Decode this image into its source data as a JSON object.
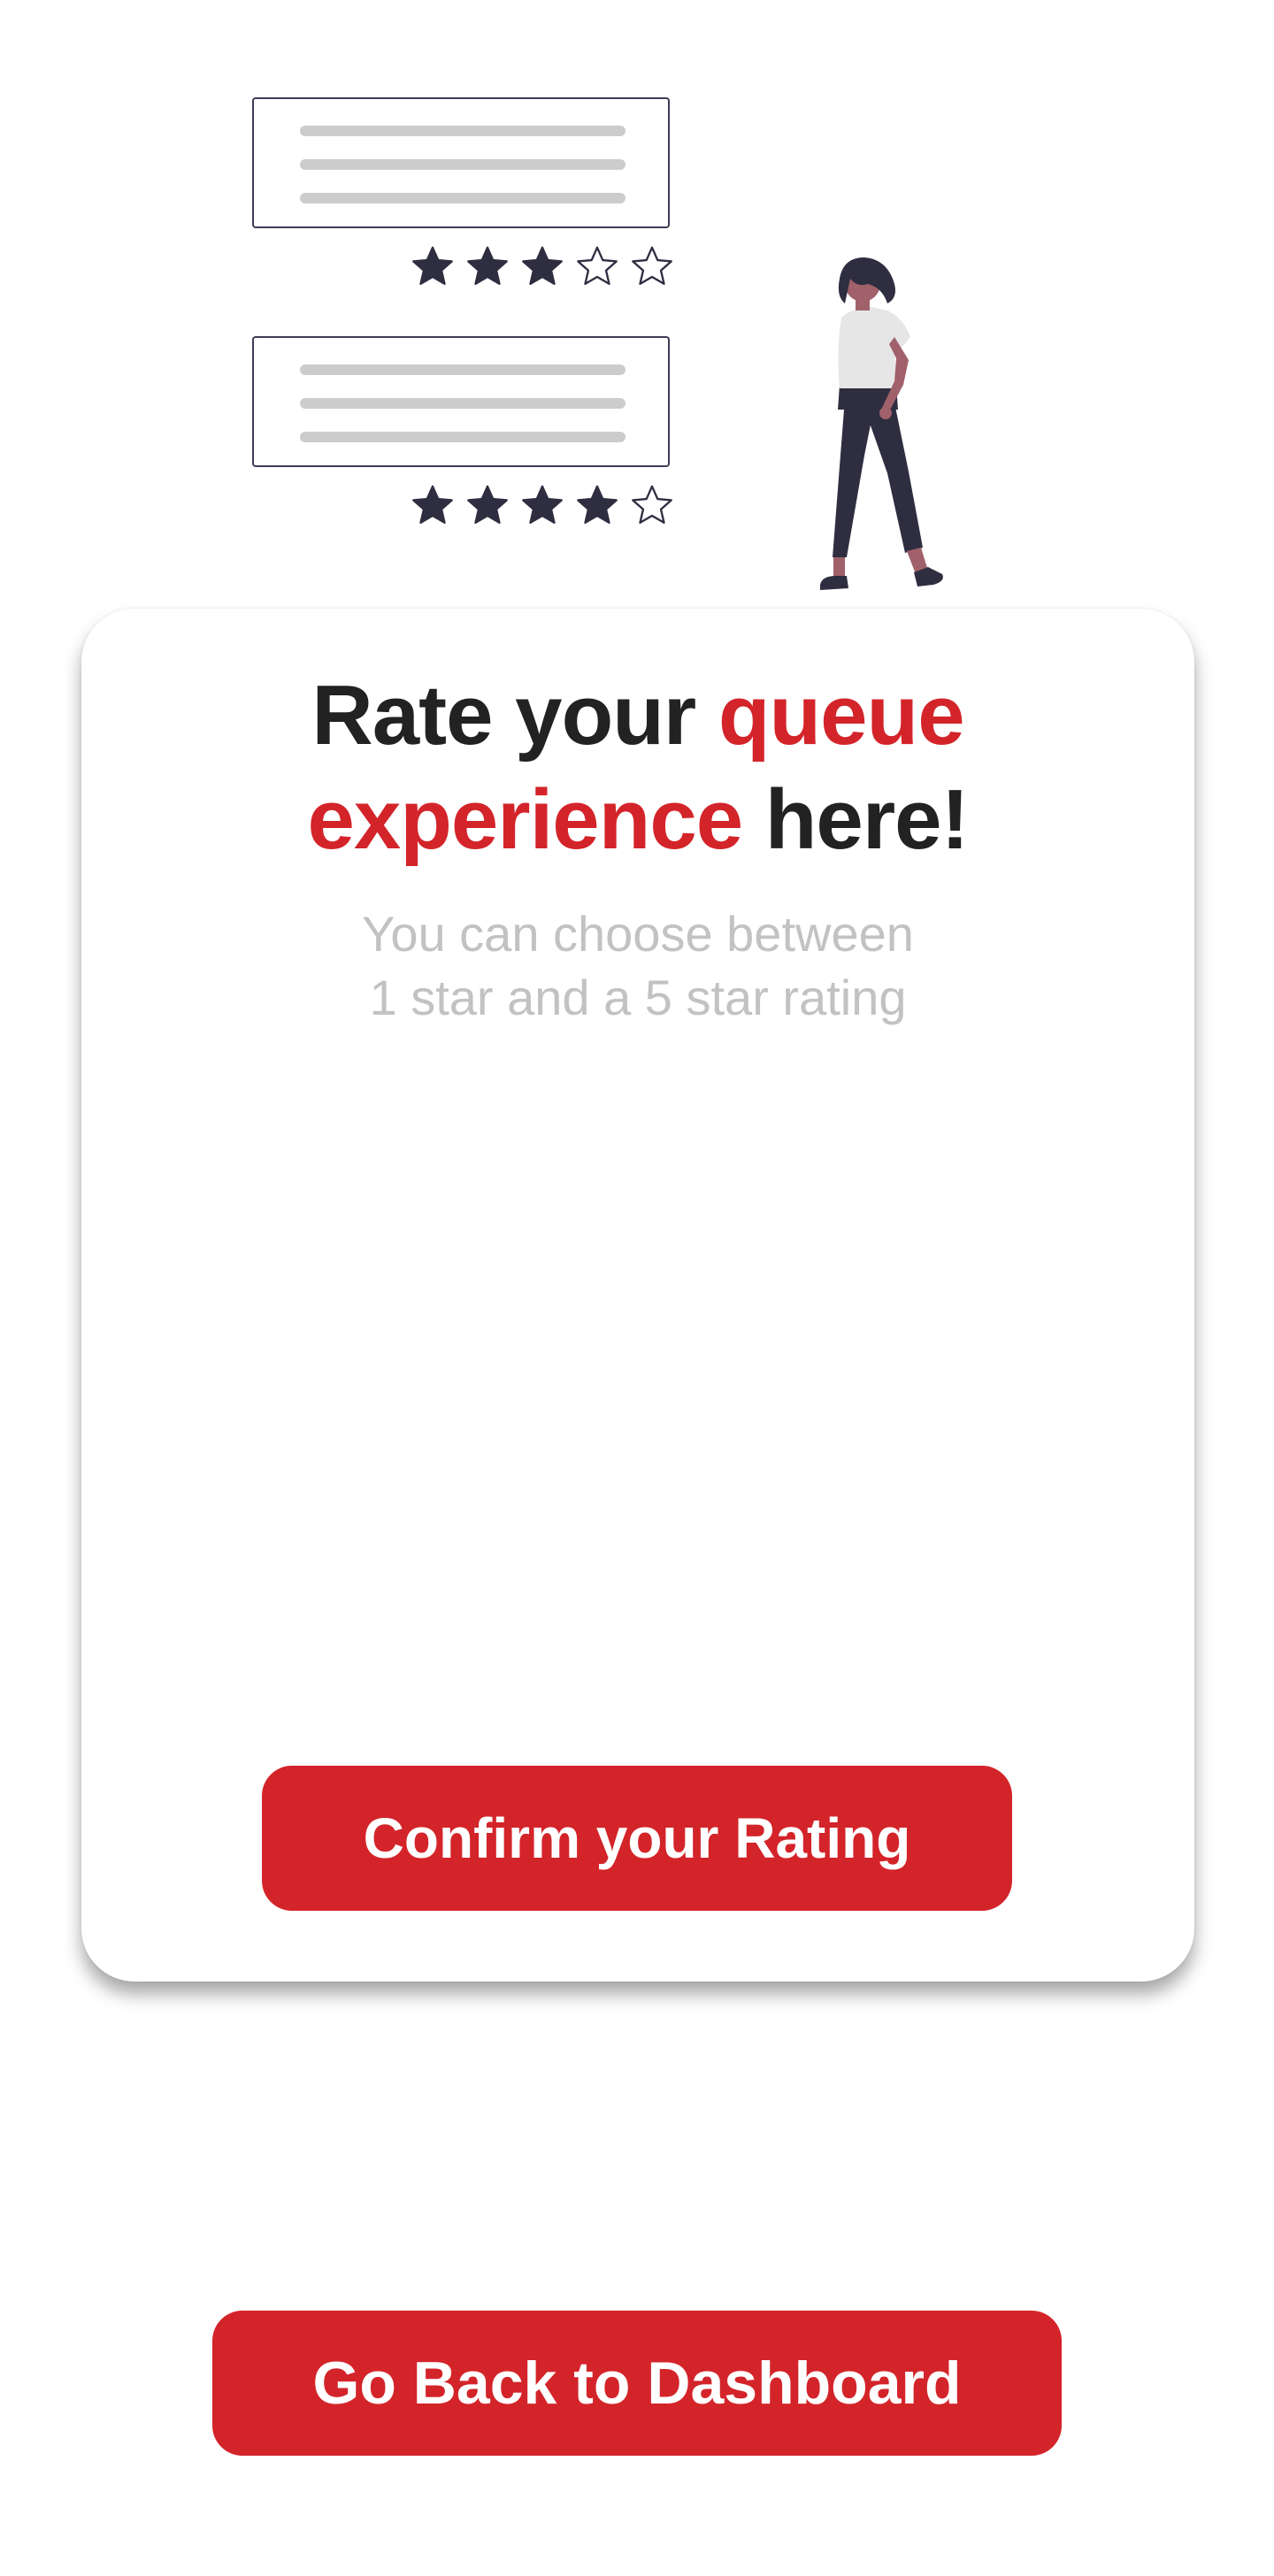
{
  "illustration": {
    "reviews": [
      {
        "rating": 3,
        "max": 5
      },
      {
        "rating": 4,
        "max": 5
      }
    ],
    "colors": {
      "card_border": "#3f3d56",
      "text_lines": "#cccccc",
      "star_fill": "#2f2e41",
      "skin": "#a0616a",
      "shirt": "#e6e6e6"
    }
  },
  "card": {
    "title_part1": "Rate your ",
    "title_accent1": "queue",
    "title_accent2": "experience",
    "title_part2": " here!",
    "subtitle_line1": "You can choose between",
    "subtitle_line2": "1 star and a 5 star rating",
    "confirm_label": "Confirm your Rating"
  },
  "footer": {
    "back_label": "Go Back to Dashboard"
  },
  "colors": {
    "accent": "#d3242a",
    "title_text": "#222222",
    "subtitle_text": "#c2c2c2",
    "button_text": "#ffffff"
  }
}
